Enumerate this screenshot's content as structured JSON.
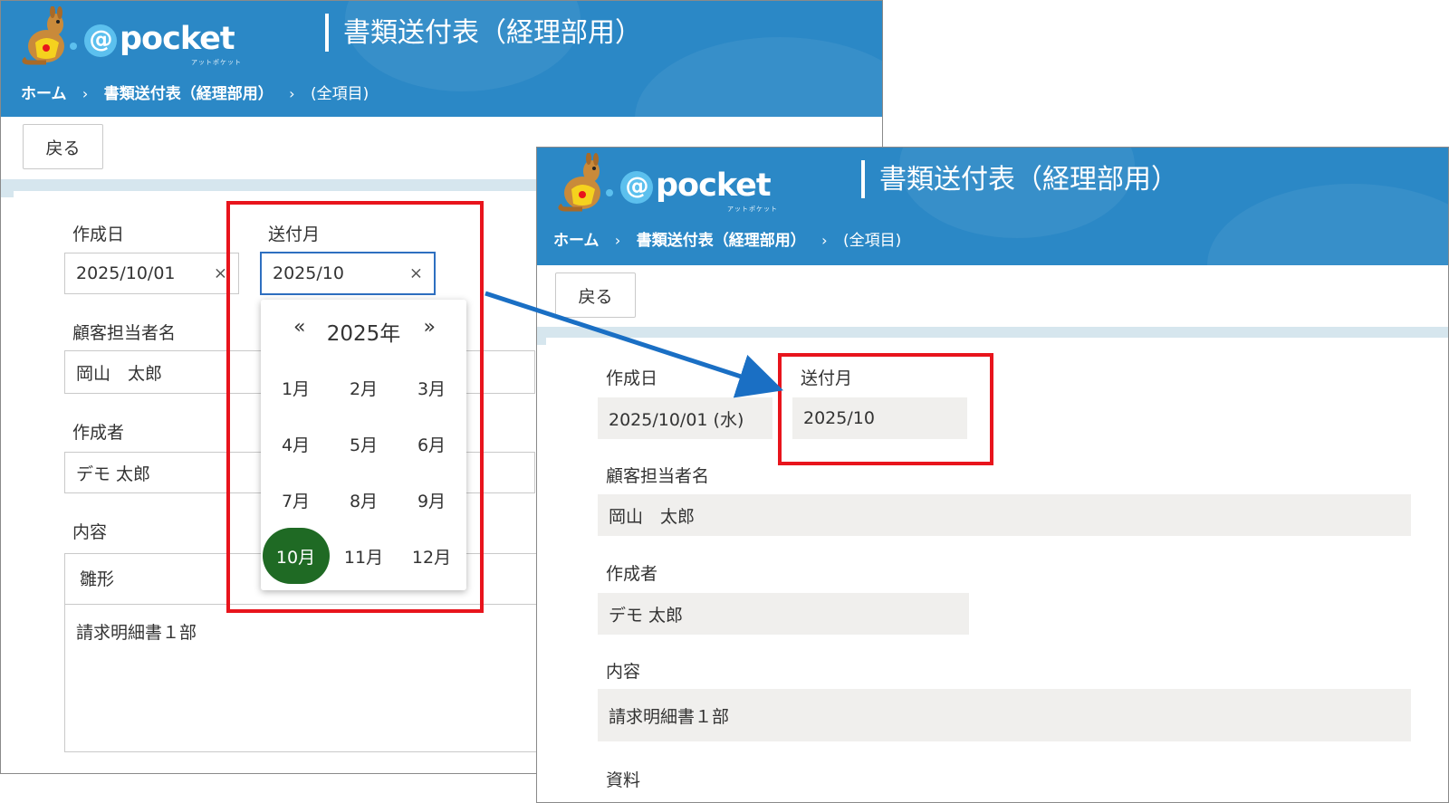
{
  "app": {
    "logo_text": "pocket",
    "logo_at": "@",
    "logo_sub": "アットポケット",
    "title": "書類送付表（経理部用）"
  },
  "breadcrumb": {
    "home": "ホーム",
    "separator": "›",
    "page": "書類送付表（経理部用）",
    "view": "(全項目)"
  },
  "buttons": {
    "back": "戻る"
  },
  "labels": {
    "created_date": "作成日",
    "send_month": "送付月",
    "client_staff": "顧客担当者名",
    "author": "作成者",
    "content": "内容",
    "documents": "資料"
  },
  "edit_form": {
    "created_date": "2025/10/01",
    "send_month": "2025/10",
    "clear_icon": "×",
    "client_staff": "岡山　太郎",
    "author": "デモ 太郎",
    "content_template": "雛形",
    "content_body": "請求明細書１部"
  },
  "month_picker": {
    "prev": "«",
    "next": "»",
    "year": "2025年",
    "months": [
      "1月",
      "2月",
      "3月",
      "4月",
      "5月",
      "6月",
      "7月",
      "8月",
      "9月",
      "10月",
      "11月",
      "12月"
    ],
    "selected": "10月"
  },
  "view_form": {
    "created_date": "2025/10/01 (水)",
    "send_month": "2025/10",
    "client_staff": "岡山　太郎",
    "author": "デモ 太郎",
    "content": "請求明細書１部"
  },
  "colors": {
    "header": "#2b88c6",
    "selected_month": "#1f6a24",
    "highlight": "#e8141c",
    "arrow": "#1a6fc4",
    "readonly_field": "#f0efed"
  },
  "icons": [
    "kangaroo-mascot-icon",
    "clear-x-icon",
    "chevron-left-double-icon",
    "chevron-right-double-icon",
    "arrow-icon"
  ]
}
